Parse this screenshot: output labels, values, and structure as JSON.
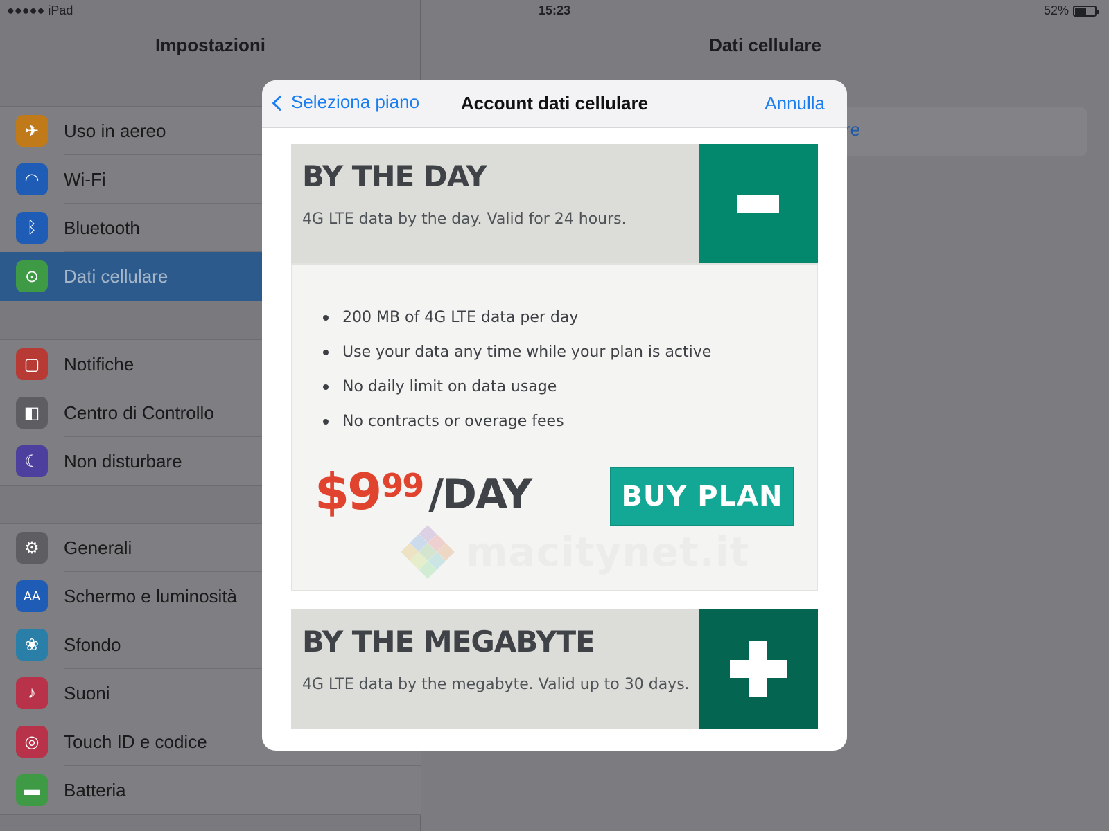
{
  "status_bar": {
    "carrier": "●●●●● iPad",
    "time": "15:23",
    "battery": "52%",
    "battery_level": 0.52
  },
  "master": {
    "title": "Impostazioni",
    "group1": [
      {
        "label": "Uso in aereo",
        "icon": "airplane-icon",
        "color": "#c07a1a",
        "glyph": "✈"
      },
      {
        "label": "Wi-Fi",
        "icon": "wifi-icon",
        "color": "#1f5cb5",
        "glyph": "◠"
      },
      {
        "label": "Bluetooth",
        "icon": "bluetooth-icon",
        "color": "#1f5cb5",
        "glyph": "ᛒ"
      },
      {
        "label": "Dati cellulare",
        "icon": "cellular-icon",
        "color": "#3f9a45",
        "glyph": "⊙",
        "selected": true
      }
    ],
    "group2": [
      {
        "label": "Notifiche",
        "icon": "notifications-icon",
        "color": "#b83a34",
        "glyph": "▢"
      },
      {
        "label": "Centro di Controllo",
        "icon": "control-center-icon",
        "color": "#5e5e62",
        "glyph": "◧"
      },
      {
        "label": "Non disturbare",
        "icon": "moon-icon",
        "color": "#4c3f9e",
        "glyph": "☾"
      }
    ],
    "group3": [
      {
        "label": "Generali",
        "icon": "gear-icon",
        "color": "#5e5e62",
        "glyph": "⚙"
      },
      {
        "label": "Schermo e luminosità",
        "icon": "display-icon",
        "color": "#1f5cb5",
        "glyph": "AA"
      },
      {
        "label": "Sfondo",
        "icon": "wallpaper-icon",
        "color": "#2a7fa8",
        "glyph": "❀"
      },
      {
        "label": "Suoni",
        "icon": "speaker-icon",
        "color": "#b8334a",
        "glyph": "♪"
      },
      {
        "label": "Touch ID e codice",
        "icon": "fingerprint-icon",
        "color": "#b8334a",
        "glyph": "◎"
      },
      {
        "label": "Batteria",
        "icon": "battery-icon",
        "color": "#3f9a45",
        "glyph": "▬"
      }
    ]
  },
  "detail": {
    "title": "Dati cellulare",
    "partial_link": "re"
  },
  "modal": {
    "back_label": "Seleziona piano",
    "title": "Account dati cellulare",
    "cancel_label": "Annulla",
    "plans": [
      {
        "name": "BY THE DAY",
        "description": "4G LTE data by the day. Valid for 24 hours.",
        "toggle": "minus",
        "toggle_color": "#03876d",
        "features": [
          "200 MB of 4G LTE data per day",
          "Use your data any time while your plan is active",
          "No daily limit on data usage",
          "No contracts or overage fees"
        ],
        "price_main": "$9",
        "price_cents": "99",
        "price_unit": "/DAY",
        "buy_label": "BUY PLAN"
      },
      {
        "name": "BY THE MEGABYTE",
        "description": "4G LTE data by the megabyte. Valid up to 30 days.",
        "toggle": "plus",
        "toggle_color": "#046551"
      }
    ],
    "watermark": "macitynet.it"
  }
}
